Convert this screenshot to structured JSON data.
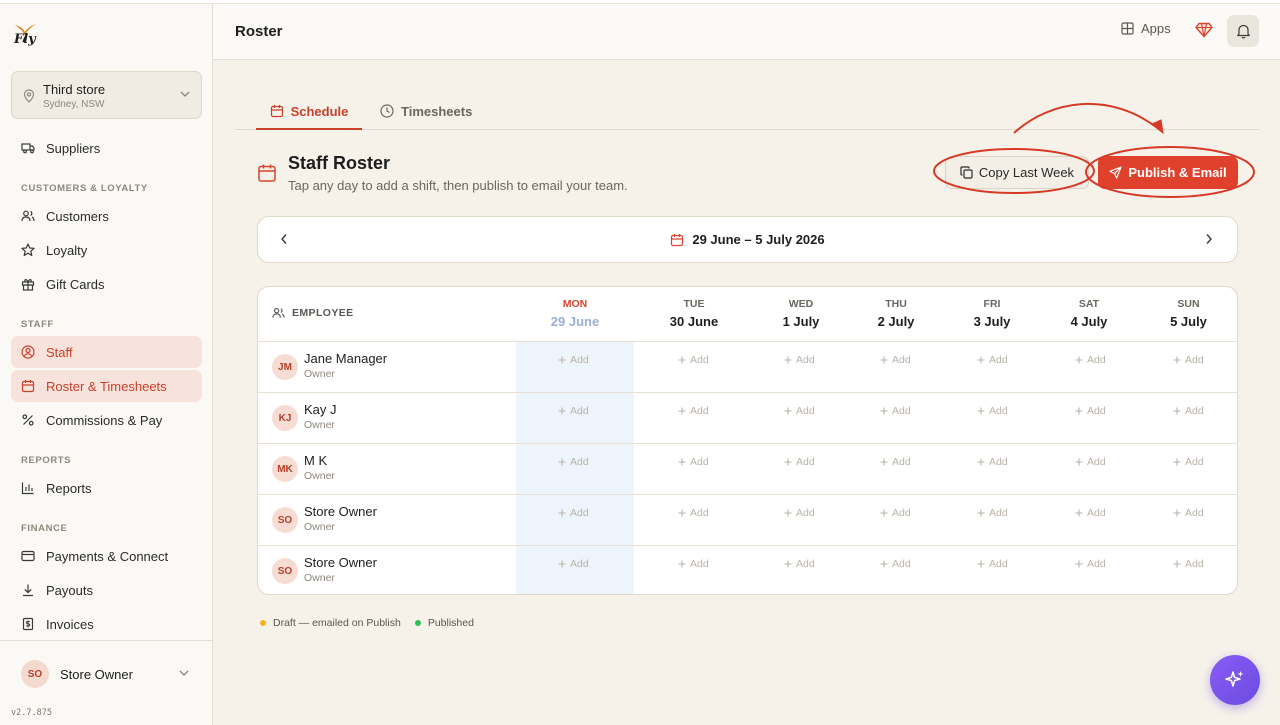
{
  "app": {
    "logo_text": "Fly",
    "version": "v2.7.875"
  },
  "store": {
    "name": "Third store",
    "location": "Sydney, NSW"
  },
  "sidebar": {
    "items": [
      {
        "label": "Suppliers",
        "icon": "truck-icon"
      },
      {
        "label": "Customers",
        "icon": "users-icon"
      },
      {
        "label": "Loyalty",
        "icon": "star-icon"
      },
      {
        "label": "Gift Cards",
        "icon": "gift-icon"
      },
      {
        "label": "Staff",
        "icon": "user-circle-icon"
      },
      {
        "label": "Roster & Timesheets",
        "icon": "calendar-icon"
      },
      {
        "label": "Commissions & Pay",
        "icon": "percent-icon"
      },
      {
        "label": "Reports",
        "icon": "bar-chart-icon"
      },
      {
        "label": "Payments & Connect",
        "icon": "credit-card-icon"
      },
      {
        "label": "Payouts",
        "icon": "download-icon"
      },
      {
        "label": "Invoices",
        "icon": "receipt-icon"
      }
    ],
    "sections": {
      "customers": "CUSTOMERS & LOYALTY",
      "staff": "STAFF",
      "reports": "REPORTS",
      "finance": "FINANCE"
    },
    "user": {
      "initials": "SO",
      "name": "Store Owner"
    }
  },
  "header": {
    "title": "Roster",
    "apps_label": "Apps"
  },
  "tabs": [
    {
      "label": "Schedule",
      "active": true
    },
    {
      "label": "Timesheets",
      "active": false
    }
  ],
  "roster": {
    "title": "Staff Roster",
    "subtitle": "Tap any day to add a shift, then publish to email your team.",
    "copy_label": "Copy Last Week",
    "publish_label": "Publish & Email",
    "week_range": "29 June – 5 July 2026",
    "employee_header": "EMPLOYEE",
    "days": [
      {
        "name": "MON",
        "date": "29 June",
        "today": true
      },
      {
        "name": "TUE",
        "date": "30 June",
        "today": false
      },
      {
        "name": "WED",
        "date": "1 July",
        "today": false
      },
      {
        "name": "THU",
        "date": "2 July",
        "today": false
      },
      {
        "name": "FRI",
        "date": "3 July",
        "today": false
      },
      {
        "name": "SAT",
        "date": "4 July",
        "today": false
      },
      {
        "name": "SUN",
        "date": "5 July",
        "today": false
      }
    ],
    "add_label": "Add",
    "employees": [
      {
        "initials": "JM",
        "name": "Jane Manager",
        "role": "Owner"
      },
      {
        "initials": "KJ",
        "name": "Kay J",
        "role": "Owner"
      },
      {
        "initials": "MK",
        "name": "M K",
        "role": "Owner"
      },
      {
        "initials": "SO",
        "name": "Store Owner",
        "role": "Owner"
      },
      {
        "initials": "SO",
        "name": "Store Owner",
        "role": "Owner"
      }
    ],
    "legend": [
      {
        "label": "Draft — emailed on Publish",
        "color": "#f2b51f"
      },
      {
        "label": "Published",
        "color": "#2fbf5b"
      }
    ]
  },
  "colors": {
    "accent": "#e0412c",
    "annotation": "#d63a26",
    "ai_fab": "#7b55ee"
  }
}
